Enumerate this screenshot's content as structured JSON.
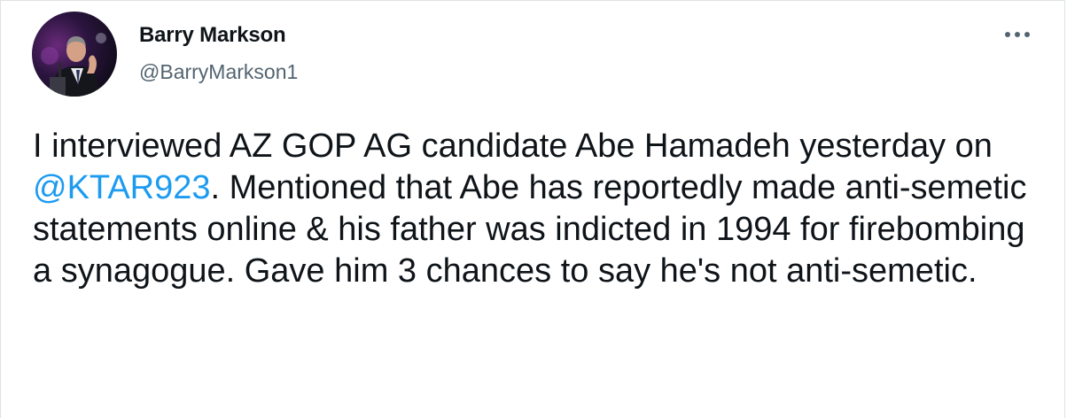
{
  "author": {
    "display_name": "Barry Markson",
    "handle": "@BarryMarkson1",
    "avatar_icon": "profile-photo"
  },
  "more_menu_icon": "ellipsis-icon",
  "tweet": {
    "text_part1": "I interviewed AZ GOP AG candidate Abe Hamadeh yesterday on ",
    "mention": "@KTAR923",
    "text_part2": ". Mention­ed that Abe has reportedly made anti-semetic statements online & his father was indicted in 1994 for firebombing a synagogue. Gave him 3 chances to say he's not anti-semetic."
  },
  "colors": {
    "link": "#1d9bf0",
    "text": "#0f1419",
    "secondary": "#536471"
  }
}
